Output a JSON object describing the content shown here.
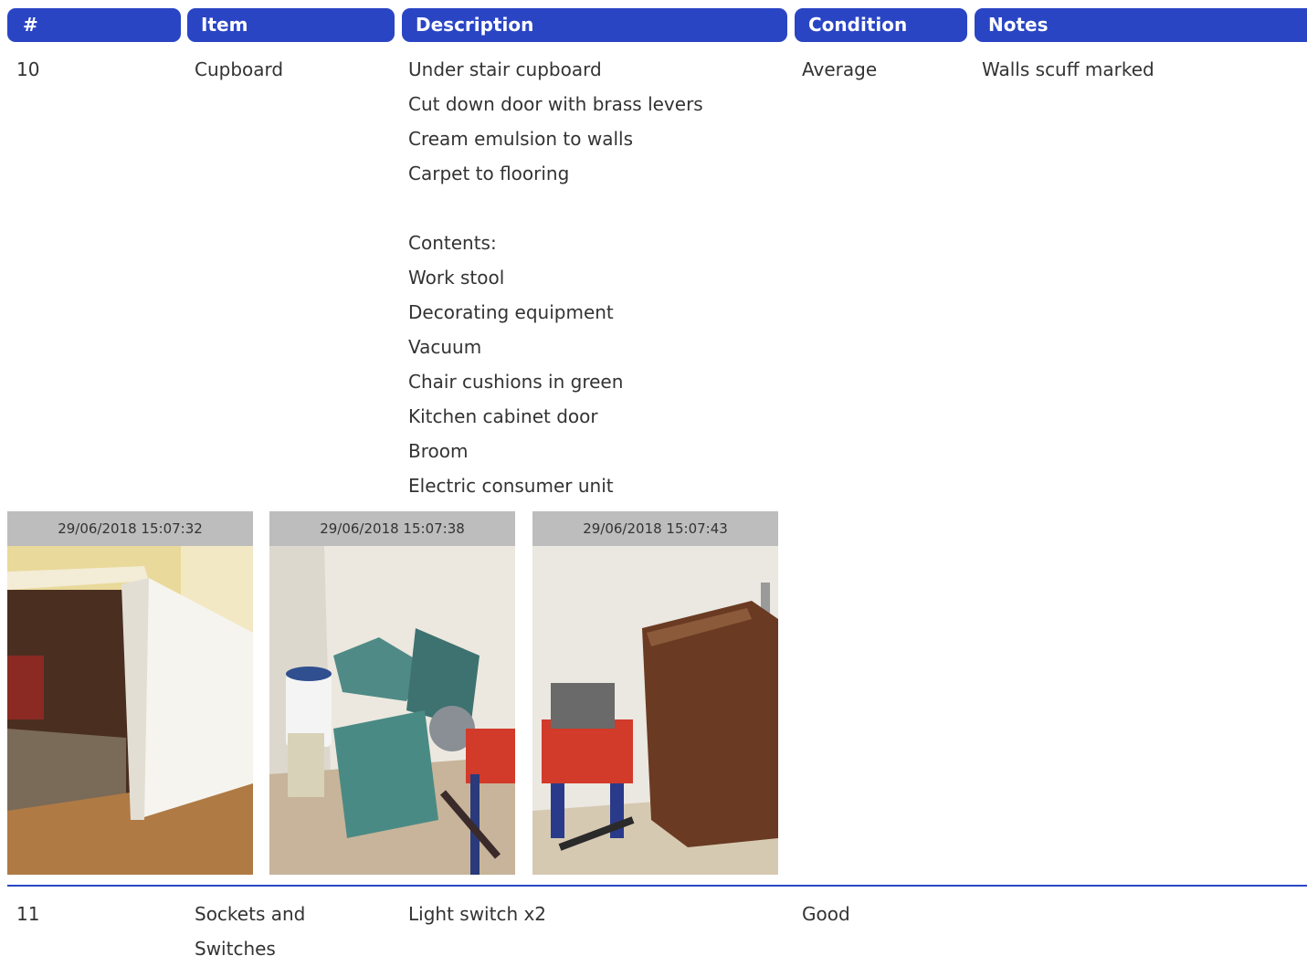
{
  "headers": {
    "num": "#",
    "item": "Item",
    "description": "Description",
    "condition": "Condition",
    "notes": "Notes"
  },
  "rows": [
    {
      "num": "10",
      "item": "Cupboard",
      "description": [
        "Under stair cupboard",
        "Cut down door with brass levers",
        "Cream emulsion to walls",
        "Carpet to flooring",
        "",
        "Contents:",
        "Work stool",
        "Decorating equipment",
        "Vacuum",
        "Chair cushions in green",
        "Kitchen cabinet door",
        "Broom",
        "Electric consumer unit"
      ],
      "condition": "Average",
      "notes": "Walls scuff marked",
      "photos": [
        "29/06/2018 15:07:32",
        "29/06/2018 15:07:38",
        "29/06/2018 15:07:43"
      ]
    },
    {
      "num": "11",
      "item_line1": "Sockets and",
      "item_line2": "Switches",
      "description": [
        "Light switch x2"
      ],
      "condition": "Good"
    }
  ]
}
